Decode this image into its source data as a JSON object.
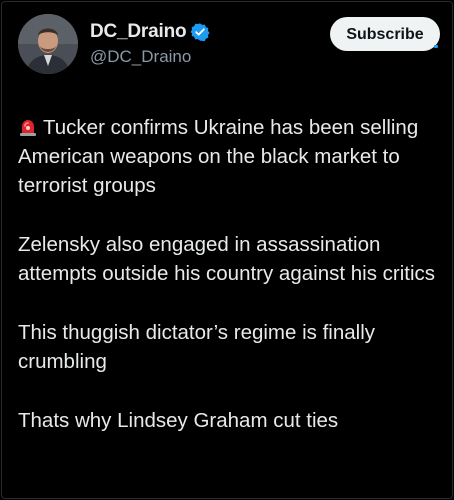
{
  "author": {
    "display_name": "DC_Draino",
    "handle": "@DC_Draino",
    "verified": true,
    "avatar_icon": "avatar-photo"
  },
  "actions": {
    "subscribe_label": "Subscribe"
  },
  "post": {
    "siren_icon": "rotating-light-emoji",
    "paragraphs": [
      "Tucker confirms Ukraine has been selling American weapons on the black market to terrorist groups",
      "Zelensky also engaged in assassination attempts outside his country against his critics",
      "This thuggish dictator’s regime is finally crumbling",
      "Thats why Lindsey Graham cut ties"
    ]
  },
  "colors": {
    "background": "#000000",
    "text": "#e7e9ea",
    "secondary_text": "#8b98a5",
    "verified_blue": "#1d9bf0",
    "button_bg": "#eff3f4",
    "button_text": "#0f1419",
    "siren_red": "#e0242b"
  }
}
